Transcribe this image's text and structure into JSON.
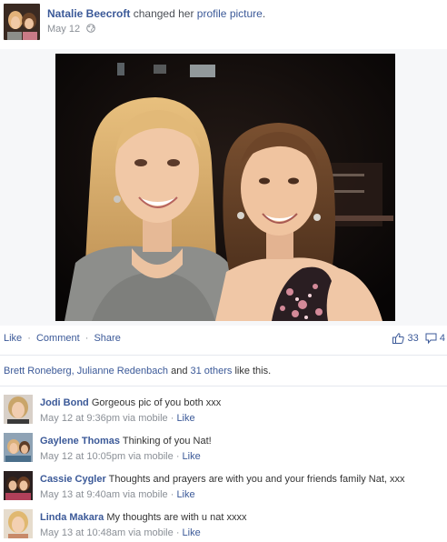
{
  "story": {
    "actor_name": "Natalie Beecroft",
    "action_text": "changed her",
    "target_text": "profile picture",
    "period": ".",
    "date": "May 12"
  },
  "actions": {
    "like": "Like",
    "comment": "Comment",
    "share": "Share",
    "separator": "·",
    "like_count": "33",
    "comment_count": "4"
  },
  "likes": {
    "names": "Brett Roneberg, Julianne Redenbach",
    "and": "and",
    "others": "31 others",
    "suffix": "like this."
  },
  "comments": [
    {
      "name": "Jodi Bond",
      "text": "Gorgeous pic of you both xxx",
      "time": "May 12 at 9:36pm via mobile",
      "sep": "·",
      "like": "Like"
    },
    {
      "name": "Gaylene Thomas",
      "text": "Thinking of you Nat!",
      "time": "May 12 at 10:05pm via mobile",
      "sep": "·",
      "like": "Like"
    },
    {
      "name": "Cassie Cygler",
      "text": "Thoughts and prayers are with you and your friends family Nat, xxx",
      "time": "May 13 at 9:40am via mobile",
      "sep": "·",
      "like": "Like"
    },
    {
      "name": "Linda Makara",
      "text": "My thoughts are with u nat xxxx",
      "time": "May 13 at 10:48am via mobile",
      "sep": "·",
      "like": "Like"
    }
  ],
  "colors": {
    "link": "#3b5998",
    "meta": "#8a8f96",
    "photo_bg": "#0d0a0a"
  },
  "icons": {
    "globe": "globe-icon",
    "like": "thumbs-up-icon",
    "comment": "comment-bubble-icon"
  }
}
